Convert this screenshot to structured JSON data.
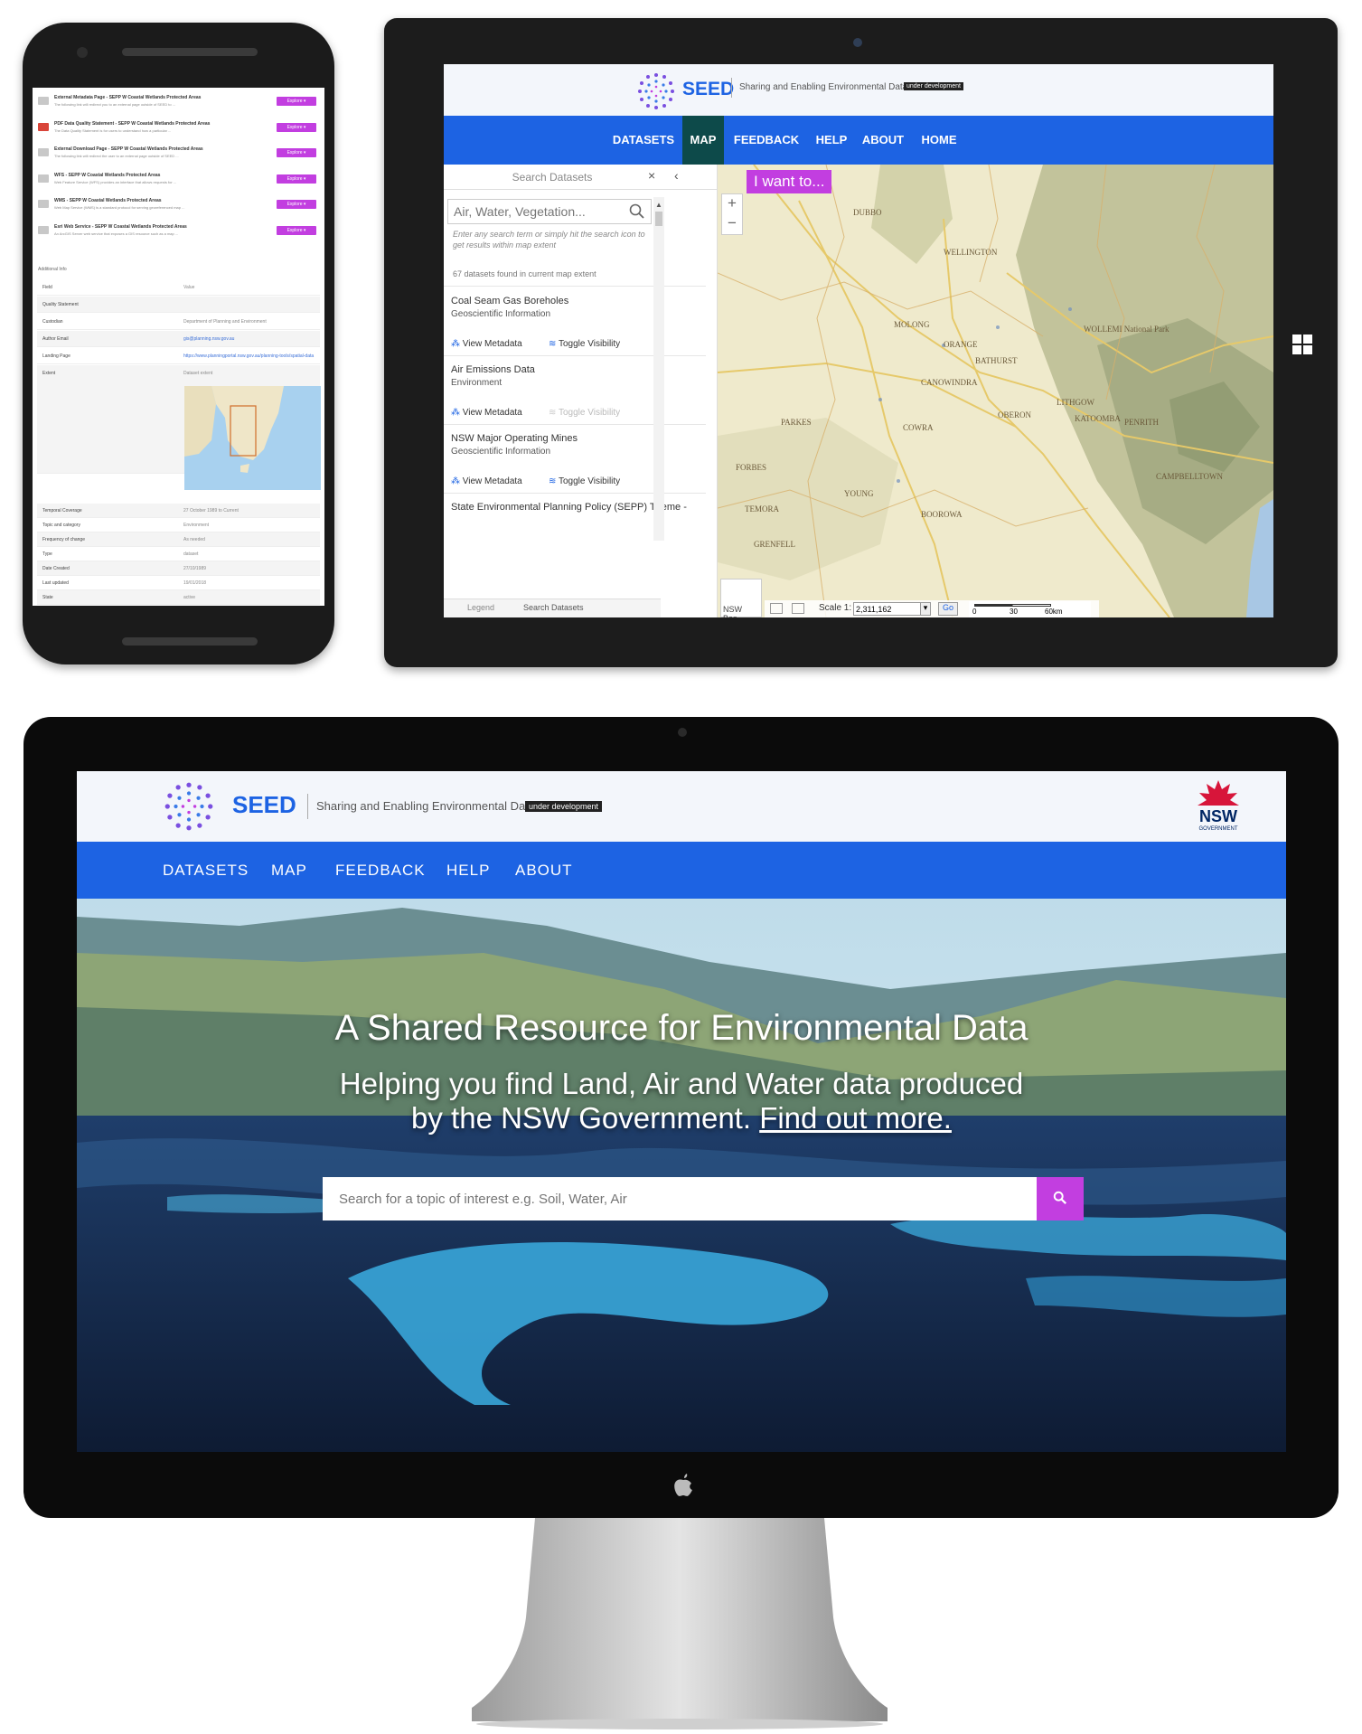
{
  "brand": {
    "name": "SEED",
    "tagline": "Sharing and Enabling Environmental Data",
    "badge": "under development",
    "nsw_logo_text": "NSW",
    "nsw_logo_sub": "GOVERNMENT",
    "colors": {
      "nav_blue": "#1d63e3",
      "accent_purple": "#c23ee0",
      "active_nav": "#0d4a4a"
    }
  },
  "phone": {
    "resources": [
      {
        "icon": "page-icon",
        "title": "External Metadata Page - SEPP W Coastal Wetlands Protected Areas",
        "desc": "The following link will redirect you to an external page outside of SEED to ...",
        "button": "Explore"
      },
      {
        "icon": "pdf-icon",
        "title": "PDF Data Quality Statement - SEPP W Coastal Wetlands Protected Areas",
        "desc": "The Data Quality Statement is for users to understand how a particular ...",
        "button": "Explore"
      },
      {
        "icon": "page-icon",
        "title": "External Download Page - SEPP W Coastal Wetlands Protected Areas",
        "desc": "The following link will redirect the user to an external page outside of SEED ...",
        "button": "Explore"
      },
      {
        "icon": "service-icon",
        "title": "WFS - SEPP W Coastal Wetlands Protected Areas",
        "desc": "Web Feature Service (WFS) provides an interface that allows requests for ...",
        "button": "Explore"
      },
      {
        "icon": "service-icon",
        "title": "WMS - SEPP W Coastal Wetlands Protected Areas",
        "desc": "Web Map Service (WMS) is a standard protocol for serving georeferenced map ...",
        "button": "Explore"
      },
      {
        "icon": "service-icon",
        "title": "Esri Web Service - SEPP W Coastal Wetlands Protected Areas",
        "desc": "An ArcGIS Server web service that exposes a GIS resource such as a map ...",
        "button": "Explore"
      }
    ],
    "additional_info_heading": "Additional Info",
    "table": [
      {
        "k": "Field",
        "v": "Value"
      },
      {
        "k": "Quality Statement",
        "v": ""
      },
      {
        "k": "Custodian",
        "v": "Department of Planning and Environment"
      },
      {
        "k": "Author Email",
        "v": "gis@planning.nsw.gov.au"
      },
      {
        "k": "Landing Page",
        "v": "https://www.planningportal.nsw.gov.au/planning-tools/spatial-data"
      },
      {
        "k": "Extent",
        "v": "Dataset extent"
      }
    ],
    "table2": [
      {
        "k": "Temporal Coverage",
        "v": "27 October 1989 to Current"
      },
      {
        "k": "Topic and category",
        "v": "Environment"
      },
      {
        "k": "Frequency of change",
        "v": "As needed"
      },
      {
        "k": "Type",
        "v": "dataset"
      },
      {
        "k": "Date Created",
        "v": "27/10/1989"
      },
      {
        "k": "Last updated",
        "v": "19/01/2018"
      },
      {
        "k": "State",
        "v": "active"
      }
    ]
  },
  "tablet": {
    "nav": [
      "DATASETS",
      "MAP",
      "FEEDBACK",
      "HELP",
      "ABOUT",
      "HOME"
    ],
    "active_nav": "MAP",
    "panel_title": "Search Datasets",
    "search_placeholder": "Air, Water, Vegetation...",
    "search_hint": "Enter any search term or simply hit the search icon to get results within map extent",
    "results_count": "67 datasets found in current map extent",
    "datasets": [
      {
        "name": "Coal Seam Gas Boreholes",
        "category": "Geoscientific Information",
        "view": "View Metadata",
        "toggle": "Toggle Visibility",
        "toggle_enabled": true
      },
      {
        "name": "Air Emissions Data",
        "category": "Environment",
        "view": "View Metadata",
        "toggle": "Toggle Visibility",
        "toggle_enabled": false
      },
      {
        "name": "NSW Major Operating Mines",
        "category": "Geoscientific Information",
        "view": "View Metadata",
        "toggle": "Toggle Visibility",
        "toggle_enabled": true
      },
      {
        "name": "State Environmental Planning Policy (SEPP) Theme -",
        "category": "",
        "view": "",
        "toggle": "",
        "toggle_enabled": true
      }
    ],
    "footer_tabs": [
      "Legend",
      "Search Datasets"
    ],
    "i_want_to": "I want to...",
    "map_labels": [
      "DUBBO",
      "WELLINGTON",
      "MOLONG",
      "ORANGE",
      "BATHURST",
      "CANOWINDRA",
      "COWRA",
      "OBERON",
      "LITHGOW",
      "KATOOMBA",
      "YOUNG",
      "BOOROWA",
      "TEMORA",
      "WOLLEMI National Park",
      "PENRITH",
      "CAMPBELLTOWN",
      "PARKES",
      "FORBES",
      "GRENFELL"
    ],
    "basemap_label": "NSW Bas...",
    "scale_label": "Scale 1:",
    "scale_value": "2,311,162",
    "go": "Go",
    "scalebar": [
      "0",
      "30",
      "60km"
    ]
  },
  "desktop": {
    "nav": [
      "DATASETS",
      "MAP",
      "FEEDBACK",
      "HELP",
      "ABOUT"
    ],
    "hero_title": "A Shared Resource for Environmental Data",
    "hero_sub_line1": "Helping you find Land, Air and Water data produced",
    "hero_sub_line2": "by the NSW Government.",
    "hero_link": "Find out more.",
    "search_placeholder": "Search for a topic of interest e.g. Soil, Water, Air"
  }
}
